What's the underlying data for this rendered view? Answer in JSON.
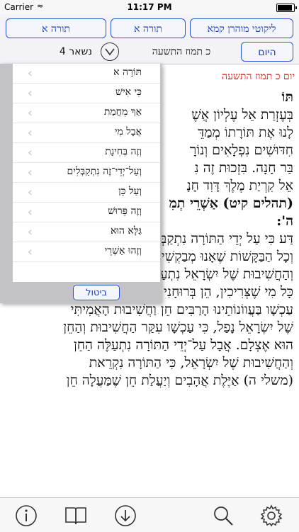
{
  "status": {
    "carrier": "Carrier",
    "time": "11:17 PM"
  },
  "toolbar": {
    "buttons": [
      "ליקוטי מוהרן קמא",
      "תורה א",
      "תורה א"
    ],
    "today_label": "היום",
    "date": "כ תמוז התשעה",
    "remaining": "נשאר 4"
  },
  "page": {
    "date_heading": "יום כ תמוז התשעה"
  },
  "menu": {
    "items": [
      "תּוֹרָה א",
      "כִּי אִישׁ",
      "אַךְ מִחֲמַת",
      "אֲבָל מִי",
      "וְזֶה בְּחִינַת",
      "וְעַל־יְדֵי־זֶה נִתְקַבְּלִים",
      "וְעַל כֵּן",
      "וְזֶה פֵּרוּשׁ",
      "גַּלָּא הוּא",
      "וְזֶהוּ אַשְׁרֵי"
    ],
    "cancel_label": "ביטול"
  },
  "content": {
    "lines": [
      "תּוֹ",
      "בְּעֶזְרַת אֵל עֶלְיוֹן אֲשֶׁ",
      "לָנוּ אֶת תּוֹרָתוֹ מְמַדֵּ",
      "חִדּוּשִׁים נִפְלָאִים וְנוֹרָ",
      "בַּר חָנָה. בִּזְכוּת זֶה נִ",
      "אֵל קִרְיַת מֶלֶךְ דָּוִד חָנָ",
      "(תהלים קיט) אַשְׁרֵי תְמִ",
      "ה':",
      "דַּע כִּי עַל יְדֵי הַתּוֹרָה נִתְקַבְּלִים כָּל הַתְּפִלּוֹת",
      "וְכָל הַבַּקָּשׁוֹת שֶׁאָנוּ מְבַקְשִׁים וּמִתְפַּלְּלִים, וְהַחֵן",
      "וְהַחֲשִׁיבוּת שֶׁל יִשְׂרָאֵל נִתְעַלֶּה וְנִתְרוֹמֵם בִּפְנֵי",
      "כָּל מִי שֶׁצְּרִיכִין, הֵן בְּרוּחָנִי הֵן בְּגַשְׁמִי; כִּי",
      "עַכְשָׁו בַּעֲווֹנוֹתֵינוּ הָרַבִּים חֵן וַחֲשִׁיבוּת הָאֲמִיתִּי",
      "שֶׁל יִשְׂרָאֵל נָפַל, כִּי עַכְשָׁו עִקַּר הַחֲשִׁיבוּת וְהַחֵן",
      "הוּא אֶצְלָם. אֲבָל עַל־יְדֵי הַתּוֹרָה נִתְעַלֶּה הַחֵן",
      "וְהַחֲשִׁיבוּת שֶׁל יִשְׂרָאֵל, כִּי הַתּוֹרָה נִקְרֵאת",
      "(משלי ה) אַיֶּלֶת אֲהָבִים וְיַעֲלַת חֵן שֶׁמַּעֲלָה חֵן"
    ]
  },
  "bottombar": {
    "icons": [
      "info-icon",
      "book-icon",
      "download-icon",
      "search-icon",
      "settings-icon"
    ]
  }
}
